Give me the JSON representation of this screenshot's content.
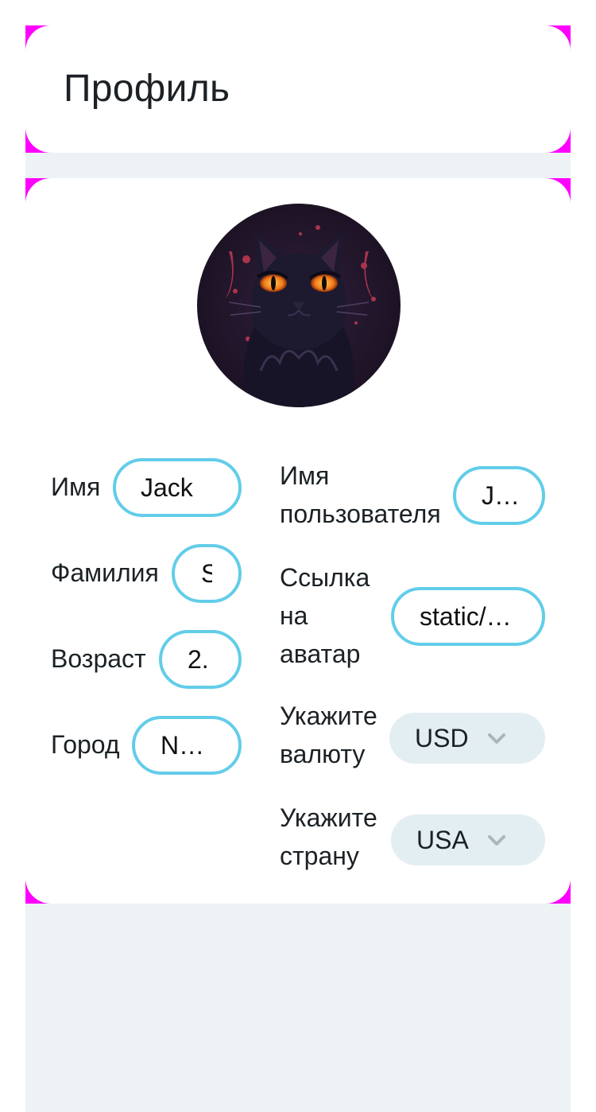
{
  "header": {
    "title": "Профиль"
  },
  "profile": {
    "avatar_alt": "Аватар",
    "fields": {
      "first_name": {
        "label": "Имя",
        "value": "Jack"
      },
      "last_name": {
        "label": "Фамилия",
        "value": "S"
      },
      "age": {
        "label": "Возраст",
        "value": "2."
      },
      "city": {
        "label": "Город",
        "value": "N…"
      },
      "username": {
        "label_line1": "Имя",
        "label_line2": "пользователя",
        "value": "J…"
      },
      "avatar_link": {
        "label_line1": "Ссылка",
        "label_line2": "на",
        "label_line3": "аватар",
        "value": "static/…"
      }
    },
    "selects": {
      "currency": {
        "label_line1": "Укажите",
        "label_line2": "валюту",
        "value": "USD"
      },
      "country": {
        "label_line1": "Укажите",
        "label_line2": "страну",
        "value": "USA"
      }
    }
  },
  "colors": {
    "accent_border": "#62cde9",
    "select_bg": "#e3eef2",
    "page_bg": "#edf2f5",
    "corner_debug": "#ff00ff"
  }
}
